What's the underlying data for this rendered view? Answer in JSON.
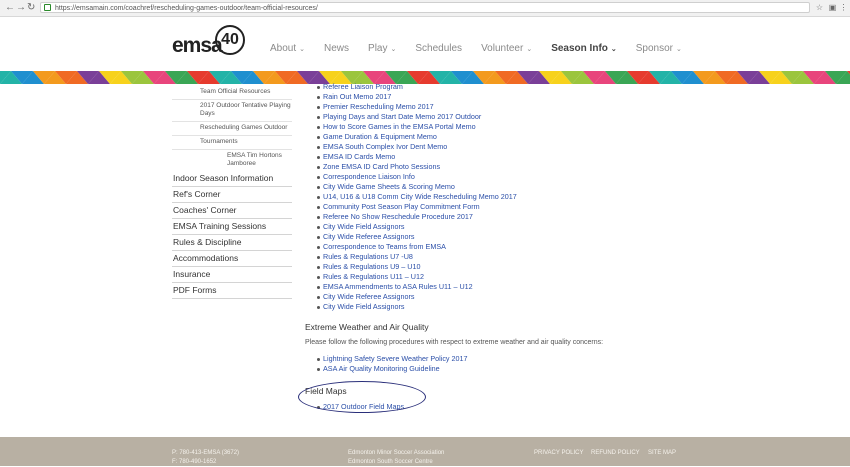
{
  "browser": {
    "url": "https://emsamain.com/coachref/rescheduling-games-outdoor/team-official-resources/"
  },
  "logo": {
    "wordmark": "emsa",
    "seal_number": "40",
    "colors": {
      "text": "#222222"
    }
  },
  "topnav": {
    "items": [
      {
        "label": "About",
        "dropdown": true,
        "active": false
      },
      {
        "label": "News",
        "dropdown": false,
        "active": false
      },
      {
        "label": "Play",
        "dropdown": true,
        "active": false
      },
      {
        "label": "Schedules",
        "dropdown": false,
        "active": false
      },
      {
        "label": "Volunteer",
        "dropdown": true,
        "active": false
      },
      {
        "label": "Season Info",
        "dropdown": true,
        "active": true
      },
      {
        "label": "Sponsor",
        "dropdown": true,
        "active": false
      }
    ]
  },
  "sidebar": {
    "subitems": [
      "Team Official Resources",
      "2017 Outdoor Tentative Playing Days",
      "Rescheduling Games Outdoor",
      "Tournaments"
    ],
    "subsubitems": [
      "EMSA Tim Hortons Jamboree"
    ],
    "main_items": [
      "Indoor Season Information",
      "Ref's Corner",
      "Coaches' Corner",
      "EMSA Training Sessions",
      "Rules & Discipline",
      "Accommodations",
      "Insurance",
      "PDF Forms"
    ]
  },
  "content": {
    "resource_links": [
      "Referee Liaison Program",
      "Rain Out Memo 2017",
      "Premier Rescheduling Memo 2017",
      "Playing Days and Start Date Memo 2017 Outdoor",
      "How to Score Games in the EMSA Portal Memo",
      "Game Duration & Equipment Memo",
      "EMSA South Complex Ivor Dent Memo",
      "EMSA ID Cards Memo",
      "Zone EMSA ID Card Photo Sessions",
      "Correspondence Liaison Info",
      "City Wide Game Sheets & Scoring Memo",
      "U14, U16 & U18 Comm City Wide Rescheduling Memo 2017",
      "Community Post Season Play Commitment Form",
      "Referee No Show Reschedule Procedure 2017",
      "City Wide Field Assignors",
      "City Wide Referee Assignors",
      "Correspondence to Teams from EMSA",
      "Rules & Regulations U7 -U8",
      "Rules & Regulations U9 – U10",
      "Rules & Regulations U11 – U12",
      "EMSA Ammendments to ASA Rules U11 – U12",
      "City Wide Referee Assignors",
      "City Wide Field Assignors"
    ],
    "weather": {
      "heading": "Extreme Weather and Air Quality",
      "text": "Please follow the following procedures with respect to extreme weather and air quality concerns:",
      "links": [
        "Lightning Safety Severe Weather Policy 2017",
        "ASA Air Quality Monitoring Guideline"
      ]
    },
    "field_maps": {
      "heading": "Field Maps",
      "links": [
        "2017 Outdoor Field Maps"
      ]
    }
  },
  "footer": {
    "phone1": "P: 780-413-EMSA (3672)",
    "phone2": "F: 780-490-1652",
    "org1": "Edmonton Minor Soccer Association",
    "org2": "Edmonton South Soccer Centre",
    "links": [
      "PRIVACY POLICY",
      "REFUND POLICY",
      "SITE MAP"
    ],
    "colors": {
      "background": "#b8b0a3",
      "text": "#f5f2ec"
    }
  },
  "colors": {
    "link": "#2b4fa8",
    "annotation_circle": "#2a2f7a"
  }
}
